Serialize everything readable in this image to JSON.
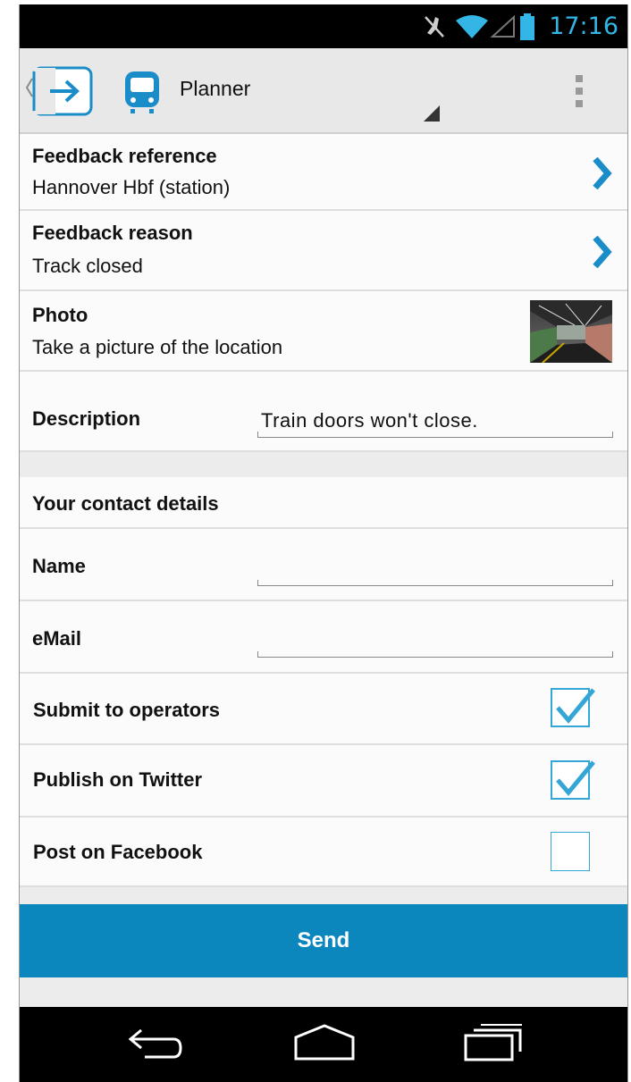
{
  "status_bar": {
    "time": "17:16"
  },
  "action_bar": {
    "title": "Planner"
  },
  "form": {
    "feedback_reference": {
      "label": "Feedback reference",
      "value": "Hannover Hbf (station)"
    },
    "feedback_reason": {
      "label": "Feedback reason",
      "value": "Track closed"
    },
    "photo": {
      "label": "Photo",
      "value": "Take a picture of the location"
    },
    "description": {
      "label": "Description",
      "value": "Train doors won't close."
    },
    "contact_header": "Your contact details",
    "name": {
      "label": "Name",
      "value": ""
    },
    "email": {
      "label": "eMail",
      "value": ""
    },
    "submit_operators": {
      "label": "Submit to operators",
      "checked": true
    },
    "publish_twitter": {
      "label": "Publish on Twitter",
      "checked": true
    },
    "post_facebook": {
      "label": "Post on Facebook",
      "checked": false
    },
    "send_label": "Send"
  },
  "colors": {
    "accent": "#33b5e5",
    "button": "#0b87be",
    "checkbox": "#33a6d6"
  }
}
